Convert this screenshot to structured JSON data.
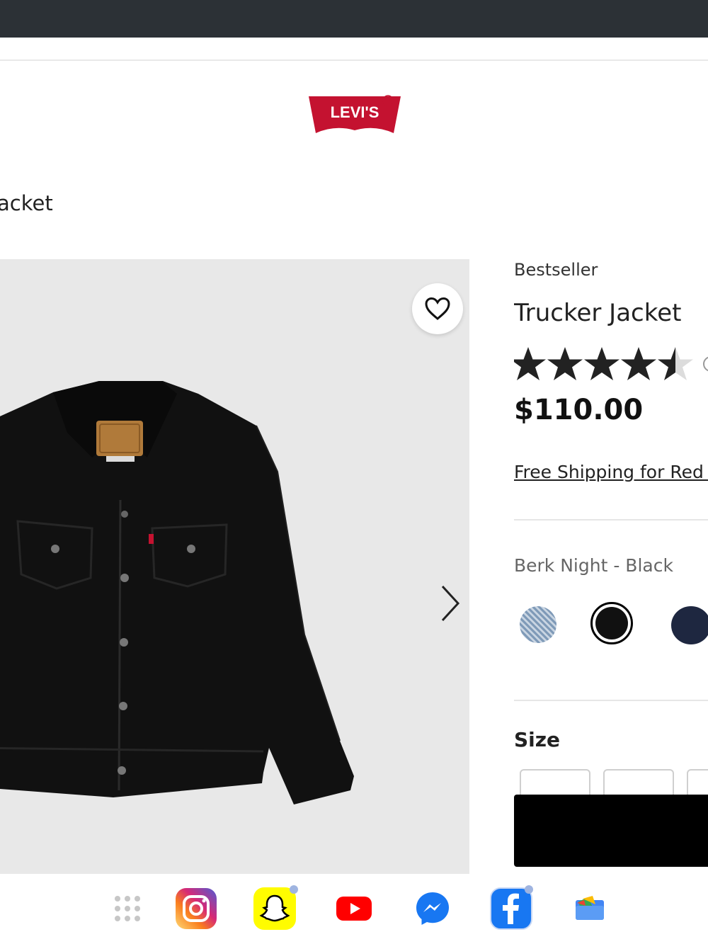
{
  "page": {
    "breadcrumb": "acket",
    "brand_logo_text": "LEVI'S"
  },
  "product": {
    "badge": "Bestseller",
    "title": "Trucker Jacket",
    "rating": 4.5,
    "rating_max": 5,
    "price": "$110.00",
    "shipping_link": "Free Shipping for Red Ta",
    "color_name": "Berk Night - Black",
    "swatches": [
      {
        "name": "Light Wash",
        "color": "#9fb2c8",
        "selected": false
      },
      {
        "name": "Berk Night - Black",
        "color": "#111111",
        "selected": true
      },
      {
        "name": "Dark Indigo",
        "color": "#1e2740",
        "selected": false
      }
    ],
    "size_label": "Size"
  },
  "colors": {
    "topbar": "#2c3136",
    "brand_red": "#c41230",
    "image_bg": "#e8e8e8"
  },
  "dock": {
    "apps": [
      {
        "name": "app-grid",
        "icon": "grid-icon"
      },
      {
        "name": "instagram",
        "icon": "instagram-icon"
      },
      {
        "name": "snapchat",
        "icon": "snapchat-icon"
      },
      {
        "name": "youtube",
        "icon": "youtube-icon"
      },
      {
        "name": "messenger",
        "icon": "messenger-icon"
      },
      {
        "name": "facebook",
        "icon": "facebook-icon"
      },
      {
        "name": "files",
        "icon": "files-icon"
      }
    ]
  }
}
